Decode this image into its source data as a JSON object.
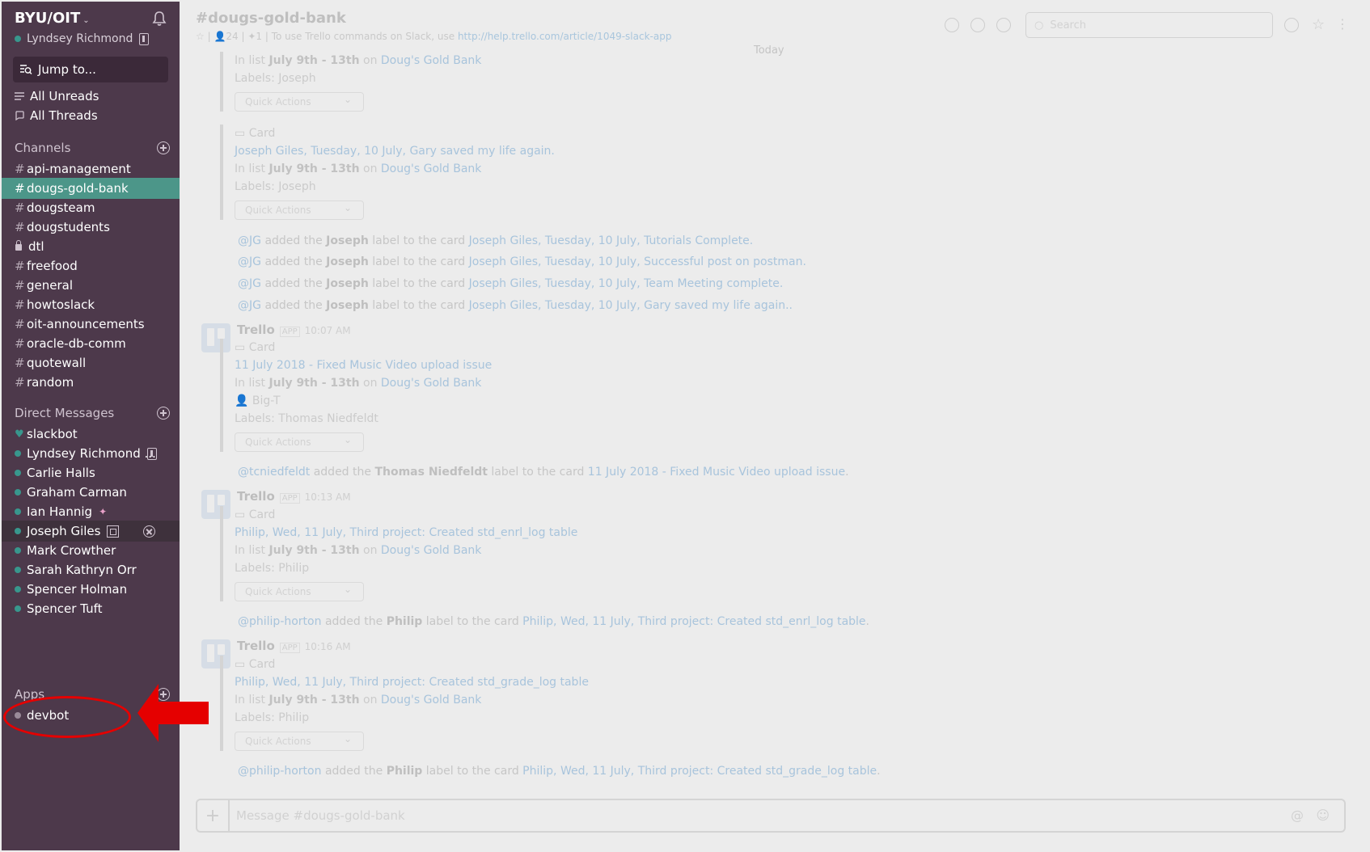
{
  "sidebar": {
    "team_name": "BYU/OIT",
    "user_name": "Lyndsey Richmond",
    "jump_placeholder": "Jump to...",
    "nav": [
      {
        "label": "All Unreads",
        "icon": "list-icon"
      },
      {
        "label": "All Threads",
        "icon": "threads-icon"
      }
    ],
    "channels_heading": "Channels",
    "channels": [
      {
        "name": "api-management",
        "type": "public"
      },
      {
        "name": "dougs-gold-bank",
        "type": "public",
        "active": true
      },
      {
        "name": "dougsteam",
        "type": "public"
      },
      {
        "name": "dougstudents",
        "type": "public"
      },
      {
        "name": "dtl",
        "type": "private"
      },
      {
        "name": "freefood",
        "type": "public"
      },
      {
        "name": "general",
        "type": "public"
      },
      {
        "name": "howtoslack",
        "type": "public"
      },
      {
        "name": "oit-announcements",
        "type": "public"
      },
      {
        "name": "oracle-db-comm",
        "type": "public"
      },
      {
        "name": "quotewall",
        "type": "public"
      },
      {
        "name": "random",
        "type": "public"
      }
    ],
    "dm_heading": "Direct Messages",
    "direct_messages": [
      {
        "name": "slackbot"
      },
      {
        "name": "Lyndsey Richmond ..."
      },
      {
        "name": "Carlie Halls"
      },
      {
        "name": "Graham Carman"
      },
      {
        "name": "Ian Hannig"
      },
      {
        "name": "Joseph Giles"
      },
      {
        "name": "Mark Crowther"
      },
      {
        "name": "Sarah Kathryn Orr"
      },
      {
        "name": "Spencer Holman"
      },
      {
        "name": "Spencer Tuft"
      }
    ],
    "apps_heading": "Apps",
    "apps": [
      {
        "name": "devbot"
      }
    ],
    "colors": {
      "bg": "#4d394b",
      "active": "#4c9689",
      "presence": "#38978d"
    }
  },
  "header": {
    "channel_title": "#dougs-gold-bank",
    "member_count": "24",
    "pinned_count": "1",
    "topic_text": "To use Trello commands on Slack, use",
    "topic_link": "http://help.trello.com/article/1049-slack-app",
    "search_placeholder": "Search"
  },
  "messages": {
    "day_divider": "Today",
    "card1": {
      "list_prefix": "In list",
      "list": "July 9th - 13th",
      "on": "on",
      "board": "Doug's Gold Bank",
      "labels": "Labels: Joseph",
      "quick_actions": "Quick Actions"
    },
    "card2": {
      "kind": "Card",
      "title": "Joseph Giles, Tuesday, 10 July, Gary saved my life again.",
      "list_prefix": "In list",
      "list": "July 9th - 13th",
      "on": "on",
      "board": "Doug's Gold Bank",
      "labels": "Labels: Joseph",
      "quick_actions": "Quick Actions"
    },
    "sys1": {
      "user": "@JG",
      "pre": "added the",
      "label": "Joseph",
      "mid": "label to the card",
      "card": "Joseph Giles, Tuesday, 10 July, Tutorials Complete."
    },
    "sys2": {
      "user": "@JG",
      "pre": "added the",
      "label": "Joseph",
      "mid": "label to the card",
      "card": "Joseph Giles, Tuesday, 10 July, Successful post on postman."
    },
    "sys3": {
      "user": "@JG",
      "pre": "added the",
      "label": "Joseph",
      "mid": "label to the card",
      "card": "Joseph Giles, Tuesday, 10 July, Team Meeting complete."
    },
    "sys4": {
      "user": "@JG",
      "pre": "added the",
      "label": "Joseph",
      "mid": "label to the card",
      "card": "Joseph Giles, Tuesday, 10 July, Gary saved my life again.."
    },
    "trello1": {
      "sender": "Trello",
      "app": "APP",
      "time": "10:07 AM",
      "kind": "Card",
      "title": "11 July 2018 - Fixed Music Video upload issue",
      "list_prefix": "In list",
      "list": "July 9th - 13th",
      "on": "on",
      "board": "Doug's Gold Bank",
      "member": "Big-T",
      "labels": "Labels: Thomas Niedfeldt",
      "quick_actions": "Quick Actions"
    },
    "sys5": {
      "user": "@tcniedfeldt",
      "pre": "added the",
      "label": "Thomas Niedfeldt",
      "mid": "label to the card",
      "card": "11 July 2018 - Fixed Music Video upload issue",
      "end": "."
    },
    "trello2": {
      "sender": "Trello",
      "app": "APP",
      "time": "10:13 AM",
      "kind": "Card",
      "title": "Philip, Wed, 11 July, Third project: Created std_enrl_log table",
      "list_prefix": "In list",
      "list": "July 9th - 13th",
      "on": "on",
      "board": "Doug's Gold Bank",
      "labels": "Labels: Philip",
      "quick_actions": "Quick Actions"
    },
    "sys6": {
      "user": "@philip-horton",
      "pre": "added the",
      "label": "Philip",
      "mid": "label to the card",
      "card": "Philip, Wed, 11 July, Third project: Created std_enrl_log table",
      "end": "."
    },
    "trello3": {
      "sender": "Trello",
      "app": "APP",
      "time": "10:16 AM",
      "kind": "Card",
      "title": "Philip, Wed, 11 July, Third project: Created std_grade_log table",
      "list_prefix": "In list",
      "list": "July 9th - 13th",
      "on": "on",
      "board": "Doug's Gold Bank",
      "labels": "Labels: Philip",
      "quick_actions": "Quick Actions"
    },
    "sys7": {
      "user": "@philip-horton",
      "pre": "added the",
      "label": "Philip",
      "mid": "label to the card",
      "card": "Philip, Wed, 11 July, Third project: Created std_grade_log table",
      "end": "."
    }
  },
  "composer": {
    "placeholder": "Message #dougs-gold-bank"
  },
  "annotation": {
    "color": "#e50000"
  }
}
